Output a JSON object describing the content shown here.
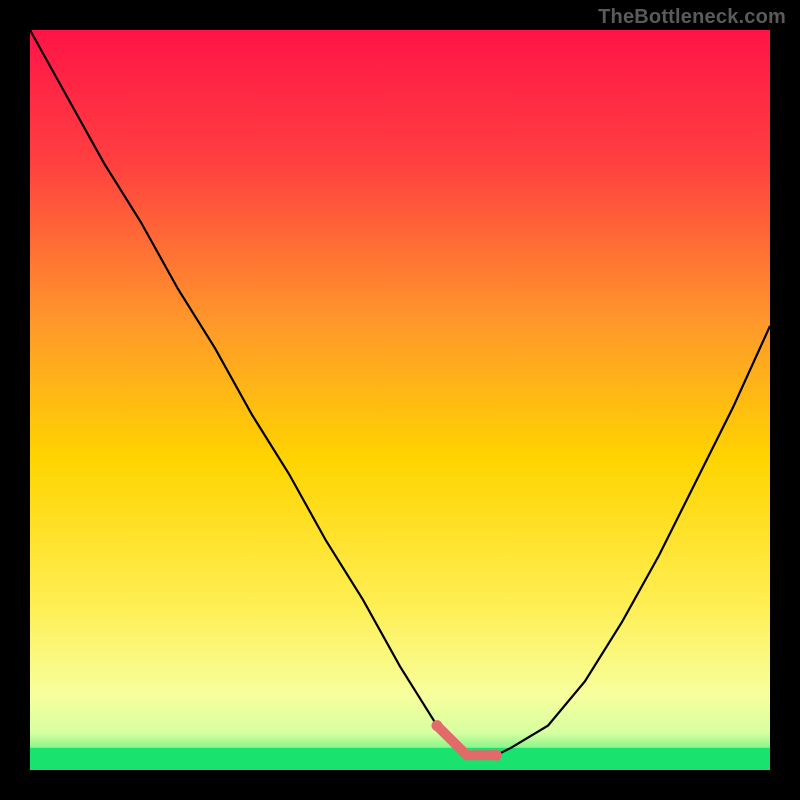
{
  "attribution": "TheBottleneck.com",
  "colors": {
    "frame": "#000000",
    "curve": "#000000",
    "good_band": "#19e36e",
    "marker": "#e36a6a",
    "gradient_top": "#ff1447",
    "gradient_mid_upper": "#ff7a2a",
    "gradient_mid": "#ffd400",
    "gradient_mid_lower": "#ffef66",
    "gradient_lower": "#f7ff9e"
  },
  "chart_data": {
    "type": "line",
    "title": "",
    "xlabel": "",
    "ylabel": "",
    "xlim": [
      0,
      100
    ],
    "ylim": [
      0,
      100
    ],
    "x": [
      0,
      5,
      10,
      15,
      20,
      25,
      30,
      35,
      40,
      45,
      50,
      55,
      56,
      57,
      58,
      59,
      60,
      61,
      62,
      63,
      65,
      70,
      75,
      80,
      85,
      90,
      95,
      100
    ],
    "values": [
      100,
      91,
      82,
      74,
      65,
      57,
      48,
      40,
      31,
      23,
      14,
      6,
      5,
      4,
      3,
      2,
      2,
      2,
      2,
      2,
      3,
      6,
      12,
      20,
      29,
      39,
      49,
      60
    ],
    "good_zone_y": [
      0,
      3
    ],
    "markers_x": [
      55,
      56,
      57,
      58,
      59,
      60,
      61,
      62,
      63
    ],
    "annotations": []
  }
}
